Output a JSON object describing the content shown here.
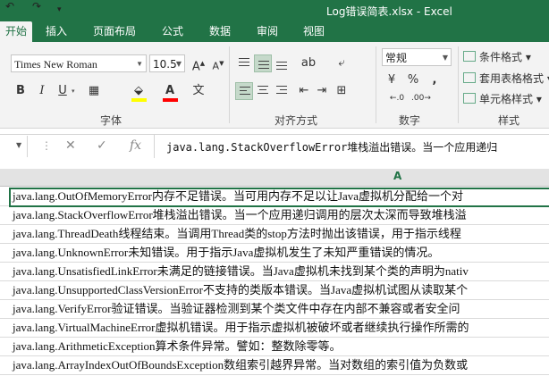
{
  "window": {
    "title": "Log错误简表.xlsx - Excel"
  },
  "ribbon": {
    "tabs": [
      "开始",
      "插入",
      "页面布局",
      "公式",
      "数据",
      "审阅",
      "视图"
    ],
    "active_tab": "开始",
    "font": {
      "name": "Times New Roman",
      "size": "10.5",
      "group_label": "字体"
    },
    "alignment": {
      "group_label": "对齐方式"
    },
    "number": {
      "format": "常规",
      "group_label": "数字",
      "percent": "%",
      "comma": ","
    },
    "styles": {
      "buttons": [
        "条件格式",
        "套用表格格式",
        "单元格样式"
      ],
      "group_label": "样式"
    }
  },
  "formula_bar": {
    "formula": "java.lang.StackOverflowError堆栈溢出错误。当一个应用递归"
  },
  "grid": {
    "column_header": "A",
    "rows": [
      "java.lang.OutOfMemoryError内存不足错误。当可用内存不足以让Java虚拟机分配给一个对",
      "java.lang.StackOverflowError堆栈溢出错误。当一个应用递归调用的层次太深而导致堆栈溢",
      "java.lang.ThreadDeath线程结束。当调用Thread类的stop方法时抛出该错误，用于指示线程",
      "java.lang.UnknownError未知错误。用于指示Java虚拟机发生了未知严重错误的情况。",
      "java.lang.UnsatisfiedLinkError未满足的链接错误。当Java虚拟机未找到某个类的声明为nativ",
      "java.lang.UnsupportedClassVersionError不支持的类版本错误。当Java虚拟机试图从读取某个",
      "java.lang.VerifyError验证错误。当验证器检测到某个类文件中存在内部不兼容或者安全问",
      "java.lang.VirtualMachineError虚拟机错误。用于指示虚拟机被破坏或者继续执行操作所需的",
      "java.lang.ArithmeticException算术条件异常。譬如：整数除零等。",
      "java.lang.ArrayIndexOutOfBoundsException数组索引越界异常。当对数组的索引值为负数或"
    ]
  }
}
